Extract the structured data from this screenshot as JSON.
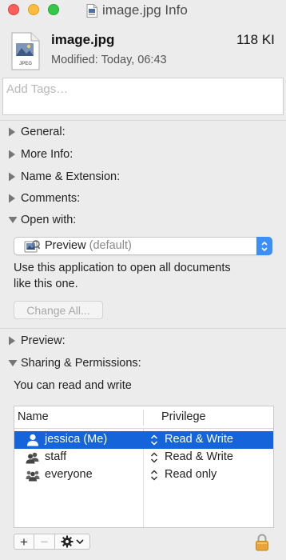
{
  "window": {
    "title": "image.jpg Info"
  },
  "file": {
    "name": "image.jpg",
    "size": "118 KI",
    "modified_label": "Modified:",
    "modified_value": "Today, 06:43",
    "icon": "jpeg-file-icon",
    "icon_caption": "JPEG"
  },
  "tags": {
    "placeholder": "Add Tags…"
  },
  "sections": {
    "general": "General:",
    "more_info": "More Info:",
    "name_extension": "Name & Extension:",
    "comments": "Comments:",
    "open_with": "Open with:",
    "preview": "Preview:",
    "sharing": "Sharing & Permissions:"
  },
  "open_with": {
    "app": "Preview",
    "app_suffix": "(default)",
    "hint_line1": "Use this application to open all documents",
    "hint_line2": "like this one.",
    "change_all_label": "Change All..."
  },
  "permissions": {
    "note": "You can read and write",
    "columns": {
      "name": "Name",
      "privilege": "Privilege"
    },
    "rows": [
      {
        "name": "jessica (Me)",
        "privilege": "Read & Write",
        "selected": true,
        "icon": "single-user-icon"
      },
      {
        "name": "staff",
        "privilege": "Read & Write",
        "selected": false,
        "icon": "group-icon"
      },
      {
        "name": "everyone",
        "privilege": "Read only",
        "selected": false,
        "icon": "everyone-icon"
      }
    ]
  },
  "toolbar": {
    "add": "+",
    "remove": "−"
  },
  "colors": {
    "selection": "#1664d9",
    "popup_accent": "#3b8ff6",
    "lock": "#e8a33b"
  }
}
